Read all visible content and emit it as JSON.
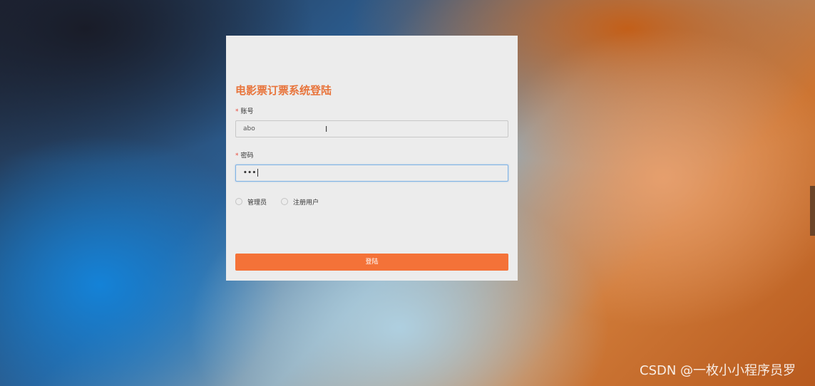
{
  "login": {
    "title": "电影票订票系统登陆",
    "required_mark": "*",
    "account_label": "账号",
    "account_value": "abo",
    "password_label": "密码",
    "password_value": "•••",
    "roles": [
      {
        "label": "管理员",
        "selected": false
      },
      {
        "label": "注册用户",
        "selected": false
      }
    ],
    "submit_label": "登陆"
  },
  "watermark": "CSDN @一枚小小程序员罗",
  "colors": {
    "accent": "#f47238",
    "title": "#e8743b",
    "card": "#ececec",
    "focus_border": "#7fb3e6"
  },
  "icons": {
    "cursor": "text-cursor-icon"
  }
}
